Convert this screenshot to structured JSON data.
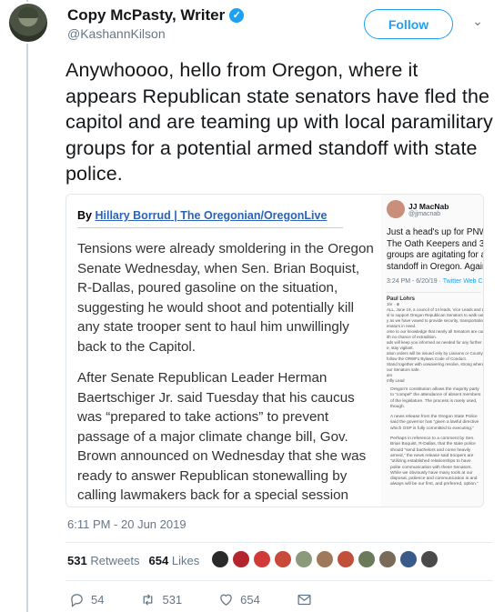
{
  "user": {
    "display_name": "Copy McPasty, Writer",
    "handle": "@KashannKilson",
    "verified_glyph": "✓",
    "follow_label": "Follow",
    "caret_glyph": "⌄"
  },
  "tweet": {
    "text": "Anywhoooo, hello from Oregon, where it appears Republican state senators have fled the capitol and are teaming up with local paramilitary groups for a potential armed standoff with state police.",
    "timestamp": "6:11 PM - 20 Jun 2019"
  },
  "article": {
    "by": "By",
    "author": "Hillary Borrud",
    "sep": " | ",
    "outlet": "The Oregonian/OregonLive",
    "paragraph1": "Tensions were already smoldering in the Oregon Senate Wednesday, when Sen. Brian Boquist, R-Dallas, poured gasoline on the situation, suggesting he would shoot and potentially kill any state trooper sent to haul him unwillingly back to the Capitol.",
    "paragraph2": "After Senate Republican Leader Herman Baertschiger Jr. said Tuesday that his caucus was “prepared to take actions” to prevent passage of a major climate change bill, Gov. Brown announced on Wednesday that she was ready to answer Republican stonewalling by calling lawmakers back for a special session"
  },
  "embedded_tweet": {
    "name": "JJ MacNab",
    "handle": "@jjmacnab",
    "line1": "Just a head's up for PNW r",
    "line2": "The Oath Keepers and 3%",
    "line3": "groups are agitating for an",
    "line4": "standoff in Oregon. Again",
    "meta": "3:24 PM - 6/20/19 · ",
    "source": "Twitter Web C"
  },
  "embedded_post": {
    "author": "Paul Lohrs",
    "lines": [
      "1hr · ⊕",
      "ALL, June 19, a council of 14 leads, Vice Leads and Liaisons f",
      "sl to support Oregon Republican Senators to walk out.",
      "y as we have vowed to provide security, transportation and re",
      "enators in need.",
      "ome to our knowledge that nearly all Senators are currently o",
      "ith no chance of extradition.",
      "ads will keep you informed as needed for any further action.",
      "e, stay vigilant.",
      "ation orders will be issued only by Liaisons or County Leads,",
      "follow the ORWFs Bylaws Code of Conduct.",
      "Stand together with unwavering resolve, strong wherever it la",
      "our Senators safe.",
      "ars",
      "mfly Lead"
    ],
    "news1": "Oregon's constitution allows the majority party to “compel” the attendance of absent members of the legislature. The process is rarely used, though.",
    "news2": "A news release from the Oregon State Police said the governor has “given a lawful directive which OSP is fully committed to executing.”",
    "news3": "Perhaps in reference to a comment by Sen. Brian Boquist, R-Dallas, that the state police should “send bachelors and come heavily armed,” the news release said troopers are “utilizing established relationships to have polite communication with these Senators. While we obviously have many tools at our disposal, patience and communication is and always will be our first, and preferred, option.”"
  },
  "stats": {
    "retweets_count": "531",
    "retweets_label": "Retweets",
    "likes_count": "654",
    "likes_label": "Likes"
  },
  "liker_colors": [
    "#2a2a2a",
    "#b3262e",
    "#d23a3a",
    "#c84a3a",
    "#8a9a7a",
    "#a0785a",
    "#c0503a",
    "#6a7a5a",
    "#7a6a5a",
    "#3a5a8a",
    "#4a4a4a"
  ],
  "actions": {
    "reply_count": "54",
    "retweet_count": "531",
    "like_count": "654"
  },
  "colors": {
    "brand": "#1da1f2",
    "muted": "#657786",
    "link": "#2a63b7"
  }
}
